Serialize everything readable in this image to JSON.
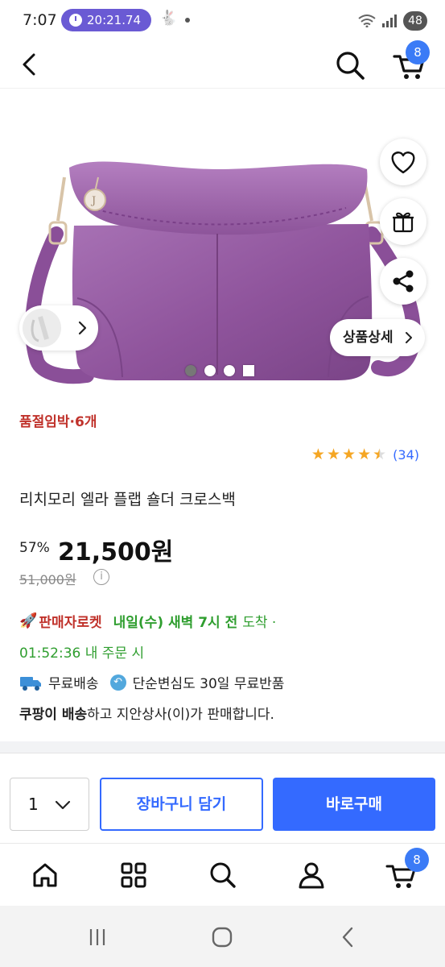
{
  "status_bar": {
    "time": "7:07",
    "timer": "20:21.74",
    "battery": "48"
  },
  "header": {
    "cart_count": "8"
  },
  "gallery": {
    "detail_label": "상품상세",
    "slide_count": 4,
    "active_slide": 1
  },
  "product": {
    "stock_notice": "품절임박·6개",
    "rating": 4.5,
    "review_count": "(34)",
    "title": "리치모리 엘라 플랩 숄더 크로스백",
    "discount": "57%",
    "price": "21,500원",
    "original_price": "51,000원"
  },
  "delivery": {
    "rocket_label": "판매자로켓",
    "arrival": "내일(수) 새벽 7시 전",
    "arrival_suffix": "도착 ·",
    "order_deadline": "01:52:36 내 주문 시",
    "shipping": "무료배송",
    "returns": "단순변심도 30일 무료반품",
    "seller_bold": "쿠팡이 배송",
    "seller_rest": "하고 지안상사(이)가 판매합니다."
  },
  "purchase": {
    "quantity": "1",
    "add_to_cart": "장바구니 담기",
    "buy_now": "바로구매"
  },
  "bottom_nav": {
    "cart_count": "8"
  },
  "colors": {
    "accent": "#346aff",
    "stock_red": "#c0322b",
    "delivery_green": "#2f9e2f",
    "star": "#f5a623",
    "product": "#9a5fa8"
  }
}
